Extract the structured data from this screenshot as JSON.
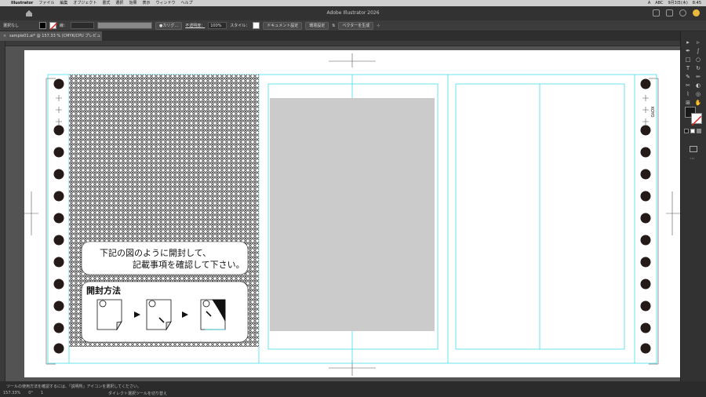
{
  "menubar": {
    "app": "Illustrator",
    "items": [
      "ファイル",
      "編集",
      "オブジェクト",
      "書式",
      "選択",
      "効果",
      "表示",
      "ウィンドウ",
      "ヘルプ"
    ],
    "right": [
      "A",
      "ABC",
      "9月3日(木)",
      "8:45"
    ]
  },
  "window": {
    "title": "Adobe Illustrator 2026"
  },
  "control": {
    "selection": "選択なし",
    "stroke_label": "線：",
    "brush": "カリグ...",
    "opacity_label": "不透明度：",
    "opacity": "100%",
    "style_label": "スタイル：",
    "doc_setup": "ドキュメント設定",
    "prefs": "環境設定",
    "vector": "ベクターを生成"
  },
  "tab": {
    "label": "sample01.ai* @ 157.33 % (CMYK/CPU プレビュー)"
  },
  "artwork": {
    "notice_line1": "下記の図のように開封して、",
    "notice_line2": "記載事項を確認して下さい。",
    "open_title": "開封方法",
    "side_text": "KOYO"
  },
  "status": {
    "tip": "ツールの使用方法を確認するには、「説明所」アイコンを選択してください。",
    "zoom": "157.33%",
    "angle": "0°",
    "page": "1",
    "hint": "ダイレクト選択ツールを切り替え"
  },
  "colors": {
    "guide": "#2bd9e8",
    "placeholder": "#cbcbcb",
    "pattern": "#2a2a2a",
    "dot": "#241a17"
  }
}
